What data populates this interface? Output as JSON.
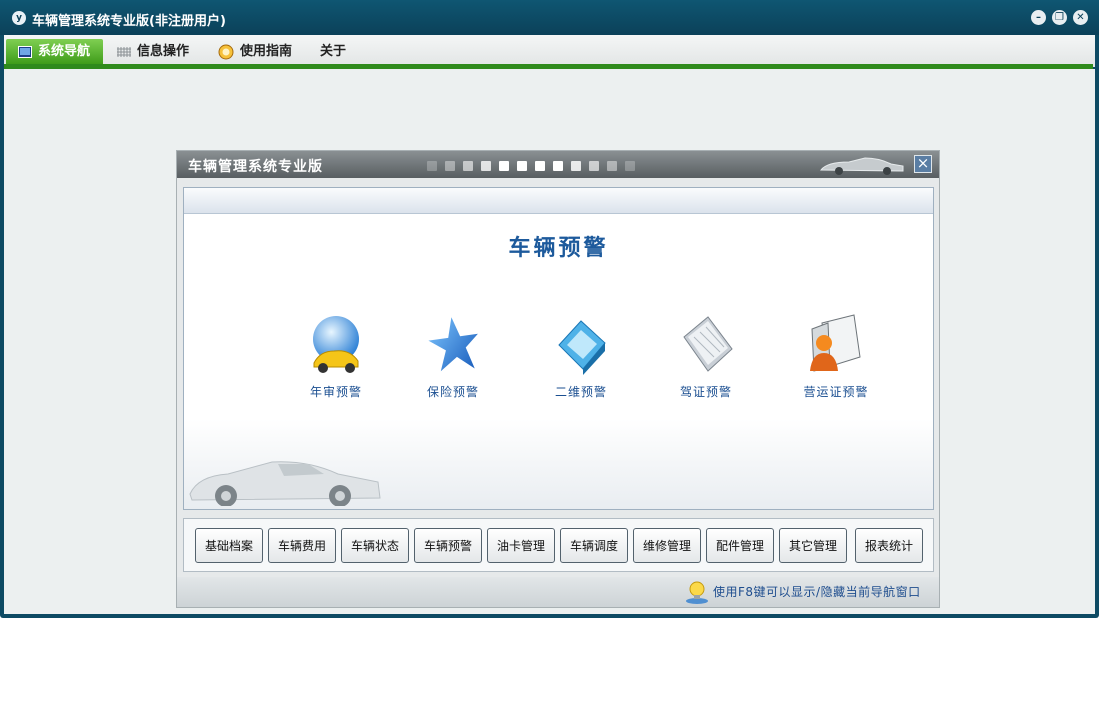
{
  "window": {
    "logo": "y",
    "title": "车辆管理系统专业版(非注册用户)",
    "controls": {
      "minimize": "–",
      "restore": "❐",
      "close": "✕"
    }
  },
  "menu": {
    "items": [
      {
        "label": "系统导航",
        "icon": "monitor-icon"
      },
      {
        "label": "信息操作",
        "icon": "grid-icon"
      },
      {
        "label": "使用指南",
        "icon": "help-circle-icon"
      },
      {
        "label": "关于",
        "icon": ""
      }
    ],
    "active_index": 0
  },
  "dialog": {
    "title": "车辆管理系统专业版",
    "close_label": "×",
    "panel_title": "车辆预警",
    "features": [
      {
        "label": "年审预警",
        "icon": "globe-car-icon"
      },
      {
        "label": "保险预警",
        "icon": "star-icon"
      },
      {
        "label": "二维预警",
        "icon": "folder-tablet-icon"
      },
      {
        "label": "驾证预警",
        "icon": "notebook-icon"
      },
      {
        "label": "营运证预警",
        "icon": "user-book-icon"
      }
    ],
    "buttons": [
      "基础档案",
      "车辆费用",
      "车辆状态",
      "车辆预警",
      "油卡管理",
      "车辆调度",
      "维修管理",
      "配件管理",
      "其它管理",
      "报表统计"
    ],
    "footer_tip": "使用F8键可以显示/隐藏当前导航窗口"
  },
  "colors": {
    "titlebar": "#0b4159",
    "menu_active": "#3f9c1a",
    "accent_text": "#1d5a9c"
  }
}
